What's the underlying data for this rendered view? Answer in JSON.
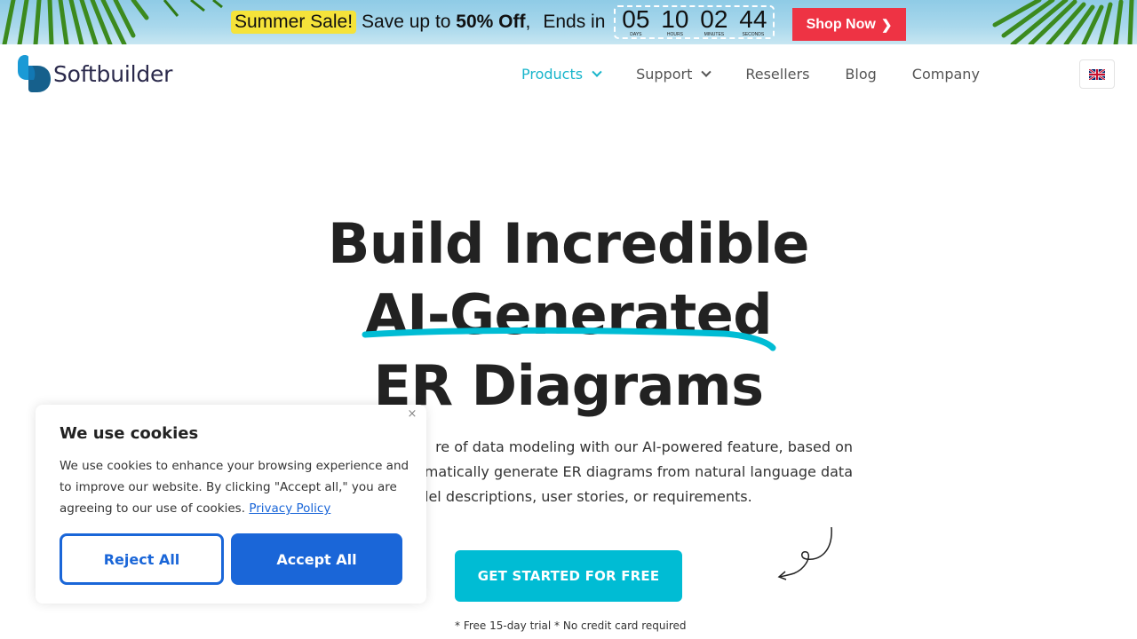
{
  "promo": {
    "sale_tag": "Summer Sale!",
    "text_prefix": "Save up to ",
    "text_bold": "50% Off",
    "text_suffix": ",",
    "ends_in": "Ends in",
    "countdown": [
      {
        "value": "05",
        "label": "DAYS"
      },
      {
        "value": "10",
        "label": "HOURS"
      },
      {
        "value": "02",
        "label": "MINUTES"
      },
      {
        "value": "44",
        "label": "SECONDS"
      }
    ],
    "shop_now_label": "Shop Now",
    "colors": {
      "sale_tag_bg": "#f5e33a",
      "shop_now_bg": "#ee3344"
    }
  },
  "header": {
    "logo_text": "Softbuilder",
    "nav": [
      {
        "label": "Products",
        "has_dropdown": true,
        "active": true
      },
      {
        "label": "Support",
        "has_dropdown": true,
        "active": false
      },
      {
        "label": "Resellers",
        "has_dropdown": false,
        "active": false
      },
      {
        "label": "Blog",
        "has_dropdown": false,
        "active": false
      },
      {
        "label": "Company",
        "has_dropdown": false,
        "active": false
      }
    ],
    "language_icon": "uk-flag-icon",
    "accent_color": "#19b5cb"
  },
  "hero": {
    "title_line1": "Build Incredible",
    "title_line2": "AI-Generated",
    "title_line3": "ER Diagrams",
    "desc_line1": "re of data modeling with our AI-powered feature, based on",
    "desc_line2": "matically generate ER diagrams from natural language data",
    "desc_line3": "lel descriptions, user stories, or requirements.",
    "cta_label": "GET STARTED FOR FREE",
    "trial_note": "* Free 15-day trial * No credit card required",
    "cta_color": "#00bcd4"
  },
  "cookie": {
    "title": "We use cookies",
    "body": "We use cookies to enhance your browsing experience and to improve our website. By clicking \"Accept all,\" you are agreeing to our use of cookies. ",
    "privacy_link": "Privacy Policy",
    "reject_label": "Reject All",
    "accept_label": "Accept All",
    "close_icon": "×",
    "button_color": "#1a66d8"
  }
}
